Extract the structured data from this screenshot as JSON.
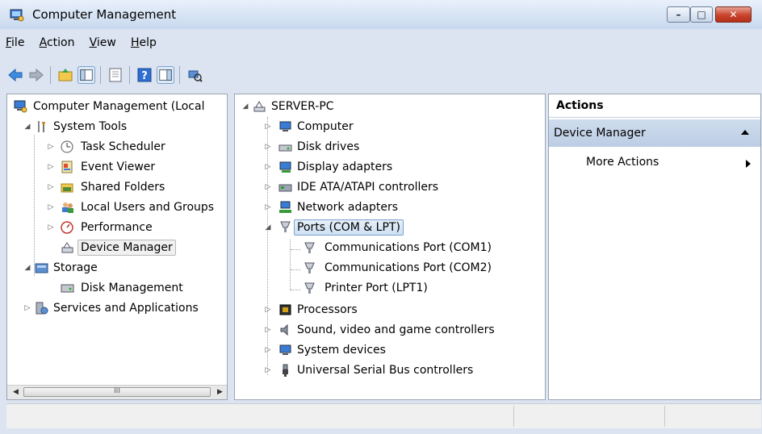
{
  "window": {
    "title": "Computer Management"
  },
  "menu": [
    {
      "label": "File",
      "accel": "F",
      "rest": "ile"
    },
    {
      "label": "Action",
      "accel": "A",
      "rest": "ction"
    },
    {
      "label": "View",
      "accel": "V",
      "rest": "iew"
    },
    {
      "label": "Help",
      "accel": "H",
      "rest": "elp"
    }
  ],
  "left_tree": {
    "root": "Computer Management (Local",
    "system_tools": "System Tools",
    "task_scheduler": "Task Scheduler",
    "event_viewer": "Event Viewer",
    "shared_folders": "Shared Folders",
    "local_users": "Local Users and Groups",
    "performance": "Performance",
    "device_manager": "Device Manager",
    "storage": "Storage",
    "disk_management": "Disk Management",
    "services_apps": "Services and Applications"
  },
  "scrollbar": {
    "thumb_grip": "III"
  },
  "device_tree": {
    "root": "SERVER-PC",
    "computer": "Computer",
    "disk_drives": "Disk drives",
    "display_adapters": "Display adapters",
    "ide": "IDE ATA/ATAPI controllers",
    "network": "Network adapters",
    "ports": "Ports (COM & LPT)",
    "com1": "Communications Port (COM1)",
    "com2": "Communications Port (COM2)",
    "lpt1": "Printer Port (LPT1)",
    "processors": "Processors",
    "sound": "Sound, video and game controllers",
    "system_devices": "System devices",
    "usb": "Universal Serial Bus controllers"
  },
  "actions": {
    "header": "Actions",
    "section": "Device Manager",
    "more": "More Actions"
  },
  "colors": {
    "selection_blue": "#cde0f4",
    "close_red": "#c9432b"
  }
}
